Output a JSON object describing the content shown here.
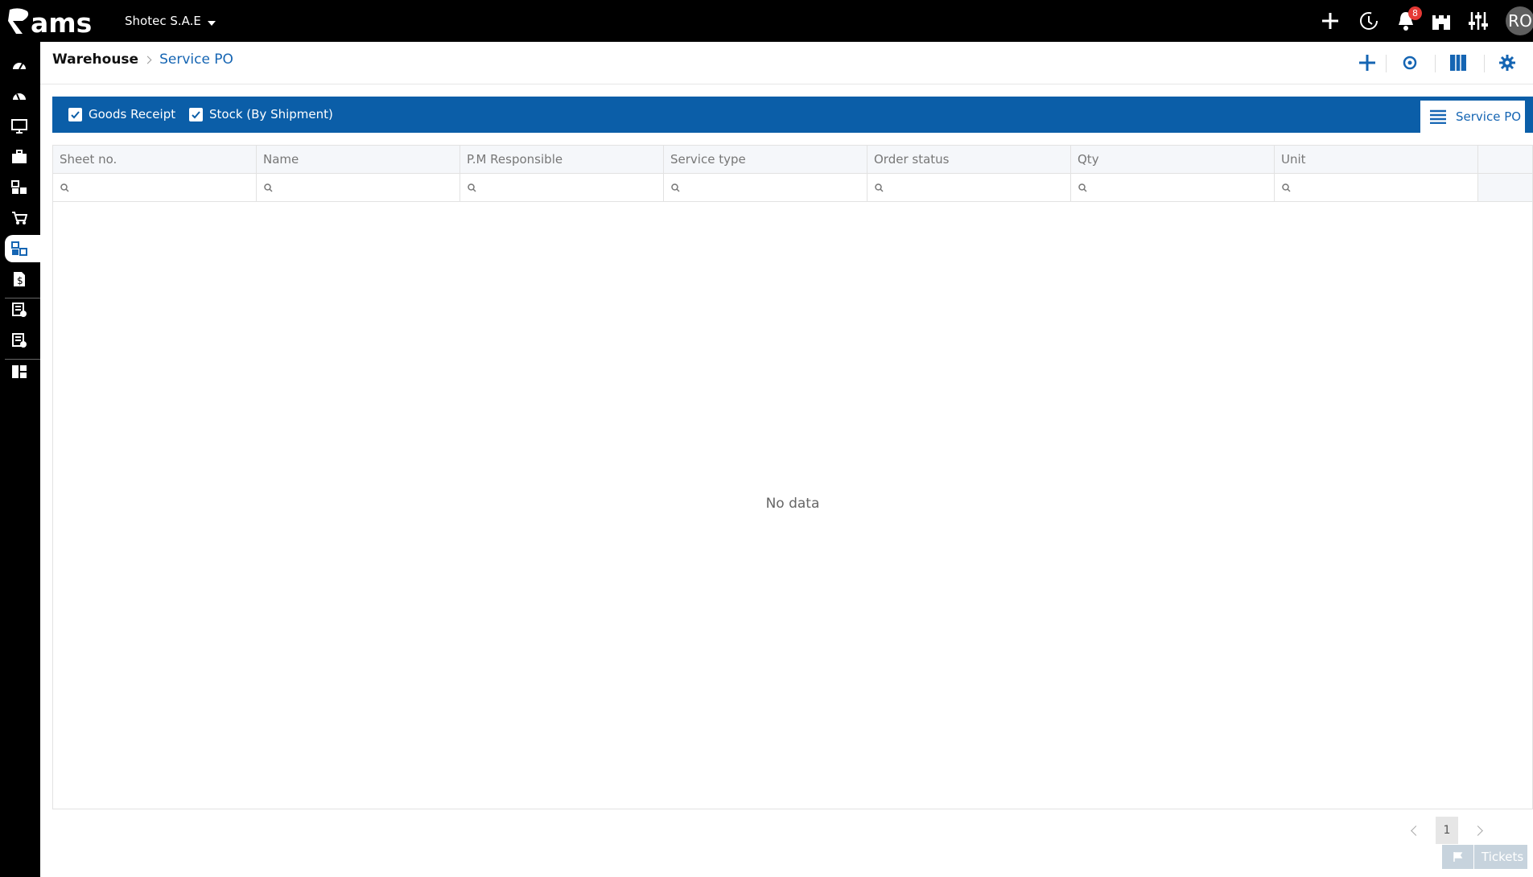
{
  "app": {
    "logo_text": "ams",
    "company": "Shotec S.A.E",
    "notification_count": "8",
    "user_initials": "RO"
  },
  "breadcrumb": {
    "parent": "Warehouse",
    "current": "Service PO"
  },
  "tabs": {
    "goods_receipt": "Goods Receipt",
    "stock_by_shipment": "Stock (By Shipment)",
    "service_po": "Service PO"
  },
  "grid": {
    "columns": [
      "Sheet no.",
      "Name",
      "P.M Responsible",
      "Service type",
      "Order status",
      "Qty",
      "Unit"
    ],
    "empty_text": "No data"
  },
  "pager": {
    "current_page": "1"
  },
  "support": {
    "tickets_label": "Tickets"
  },
  "colors": {
    "primary": "#0b5ea8",
    "link": "#1565b3",
    "topbar": "#000000",
    "badge": "#e53935"
  }
}
